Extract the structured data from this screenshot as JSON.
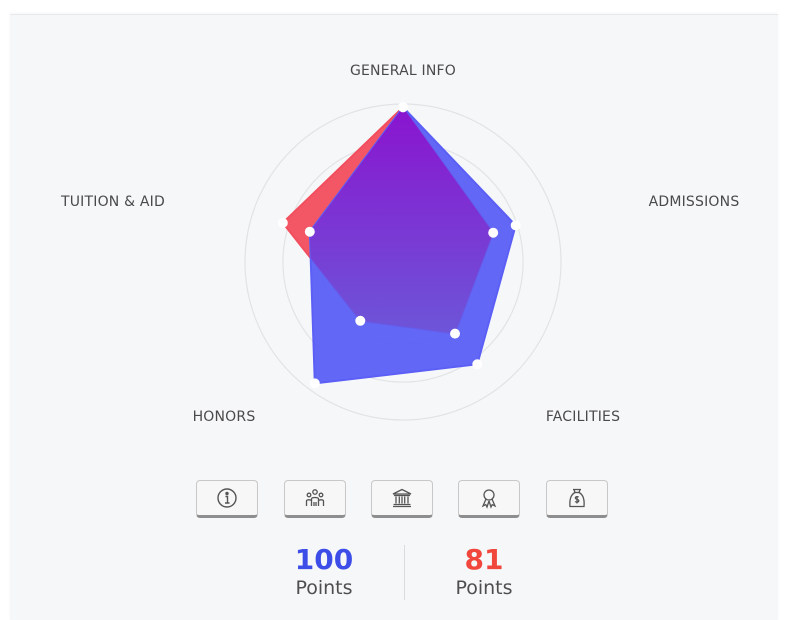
{
  "chart_data": {
    "type": "radar",
    "axes": [
      "GENERAL INFO",
      "ADMISSIONS",
      "FACILITIES",
      "HONORS",
      "TUITION & AID"
    ],
    "series": [
      {
        "values": [
          0.98,
          0.75,
          0.8,
          0.95,
          0.62
        ],
        "color": "#5b5ff5"
      },
      {
        "values": [
          0.98,
          0.6,
          0.56,
          0.46,
          0.8
        ],
        "color": "#f24e5e"
      }
    ],
    "rings": 3,
    "grid": true
  },
  "icons": [
    {
      "name": "info-icon"
    },
    {
      "name": "people-icon"
    },
    {
      "name": "institution-icon"
    },
    {
      "name": "award-ribbon-icon"
    },
    {
      "name": "money-bag-icon"
    }
  ],
  "scores": {
    "left": {
      "value": "100",
      "unit": "Points",
      "color": "#3d4ee8"
    },
    "right": {
      "value": "81",
      "unit": "Points",
      "color": "#f0463c"
    }
  }
}
